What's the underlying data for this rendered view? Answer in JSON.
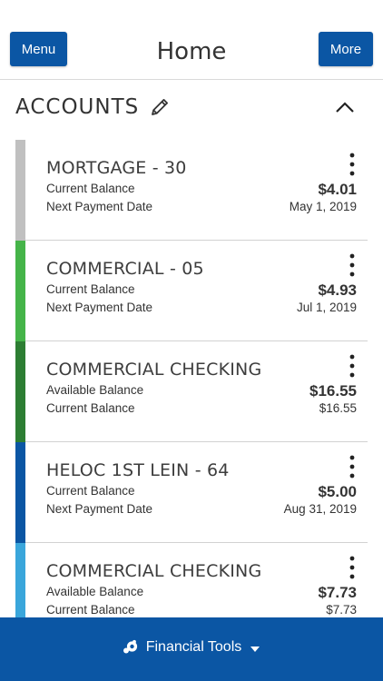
{
  "header": {
    "menu_label": "Menu",
    "more_label": "More",
    "title": "Home"
  },
  "accounts_section": {
    "title": "ACCOUNTS",
    "icons": {
      "edit": "pencil-icon",
      "collapse": "chevron-up-icon"
    }
  },
  "accounts": [
    {
      "name": "MORTGAGE - 30",
      "color": "#c0c0c0",
      "label1": "Current Balance",
      "value1": "$4.01",
      "label2": "Next Payment Date",
      "value2": "May 1, 2019"
    },
    {
      "name": "COMMERCIAL - 05",
      "color": "#45b449",
      "label1": "Current Balance",
      "value1": "$4.93",
      "label2": "Next Payment Date",
      "value2": "Jul 1, 2019"
    },
    {
      "name": "COMMERCIAL CHECKING",
      "color": "#2d7e33",
      "label1": "Available Balance",
      "value1": "$16.55",
      "label2": "Current Balance",
      "value2": "$16.55"
    },
    {
      "name": "HELOC 1ST LEIN - 64",
      "color": "#0b56a4",
      "label1": "Current Balance",
      "value1": "$5.00",
      "label2": "Next Payment Date",
      "value2": "Aug 31, 2019"
    },
    {
      "name": "COMMERCIAL CHECKING",
      "color": "#3aa6db",
      "label1": "Available Balance",
      "value1": "$7.73",
      "label2": "Current Balance",
      "value2": "$7.73"
    }
  ],
  "footer": {
    "label": "Financial Tools",
    "icons": {
      "tools": "financial-tools-icon",
      "caret": "caret-down-icon"
    }
  },
  "colors": {
    "brand_blue": "#0b56a4",
    "divider": "#d2d2d2"
  }
}
